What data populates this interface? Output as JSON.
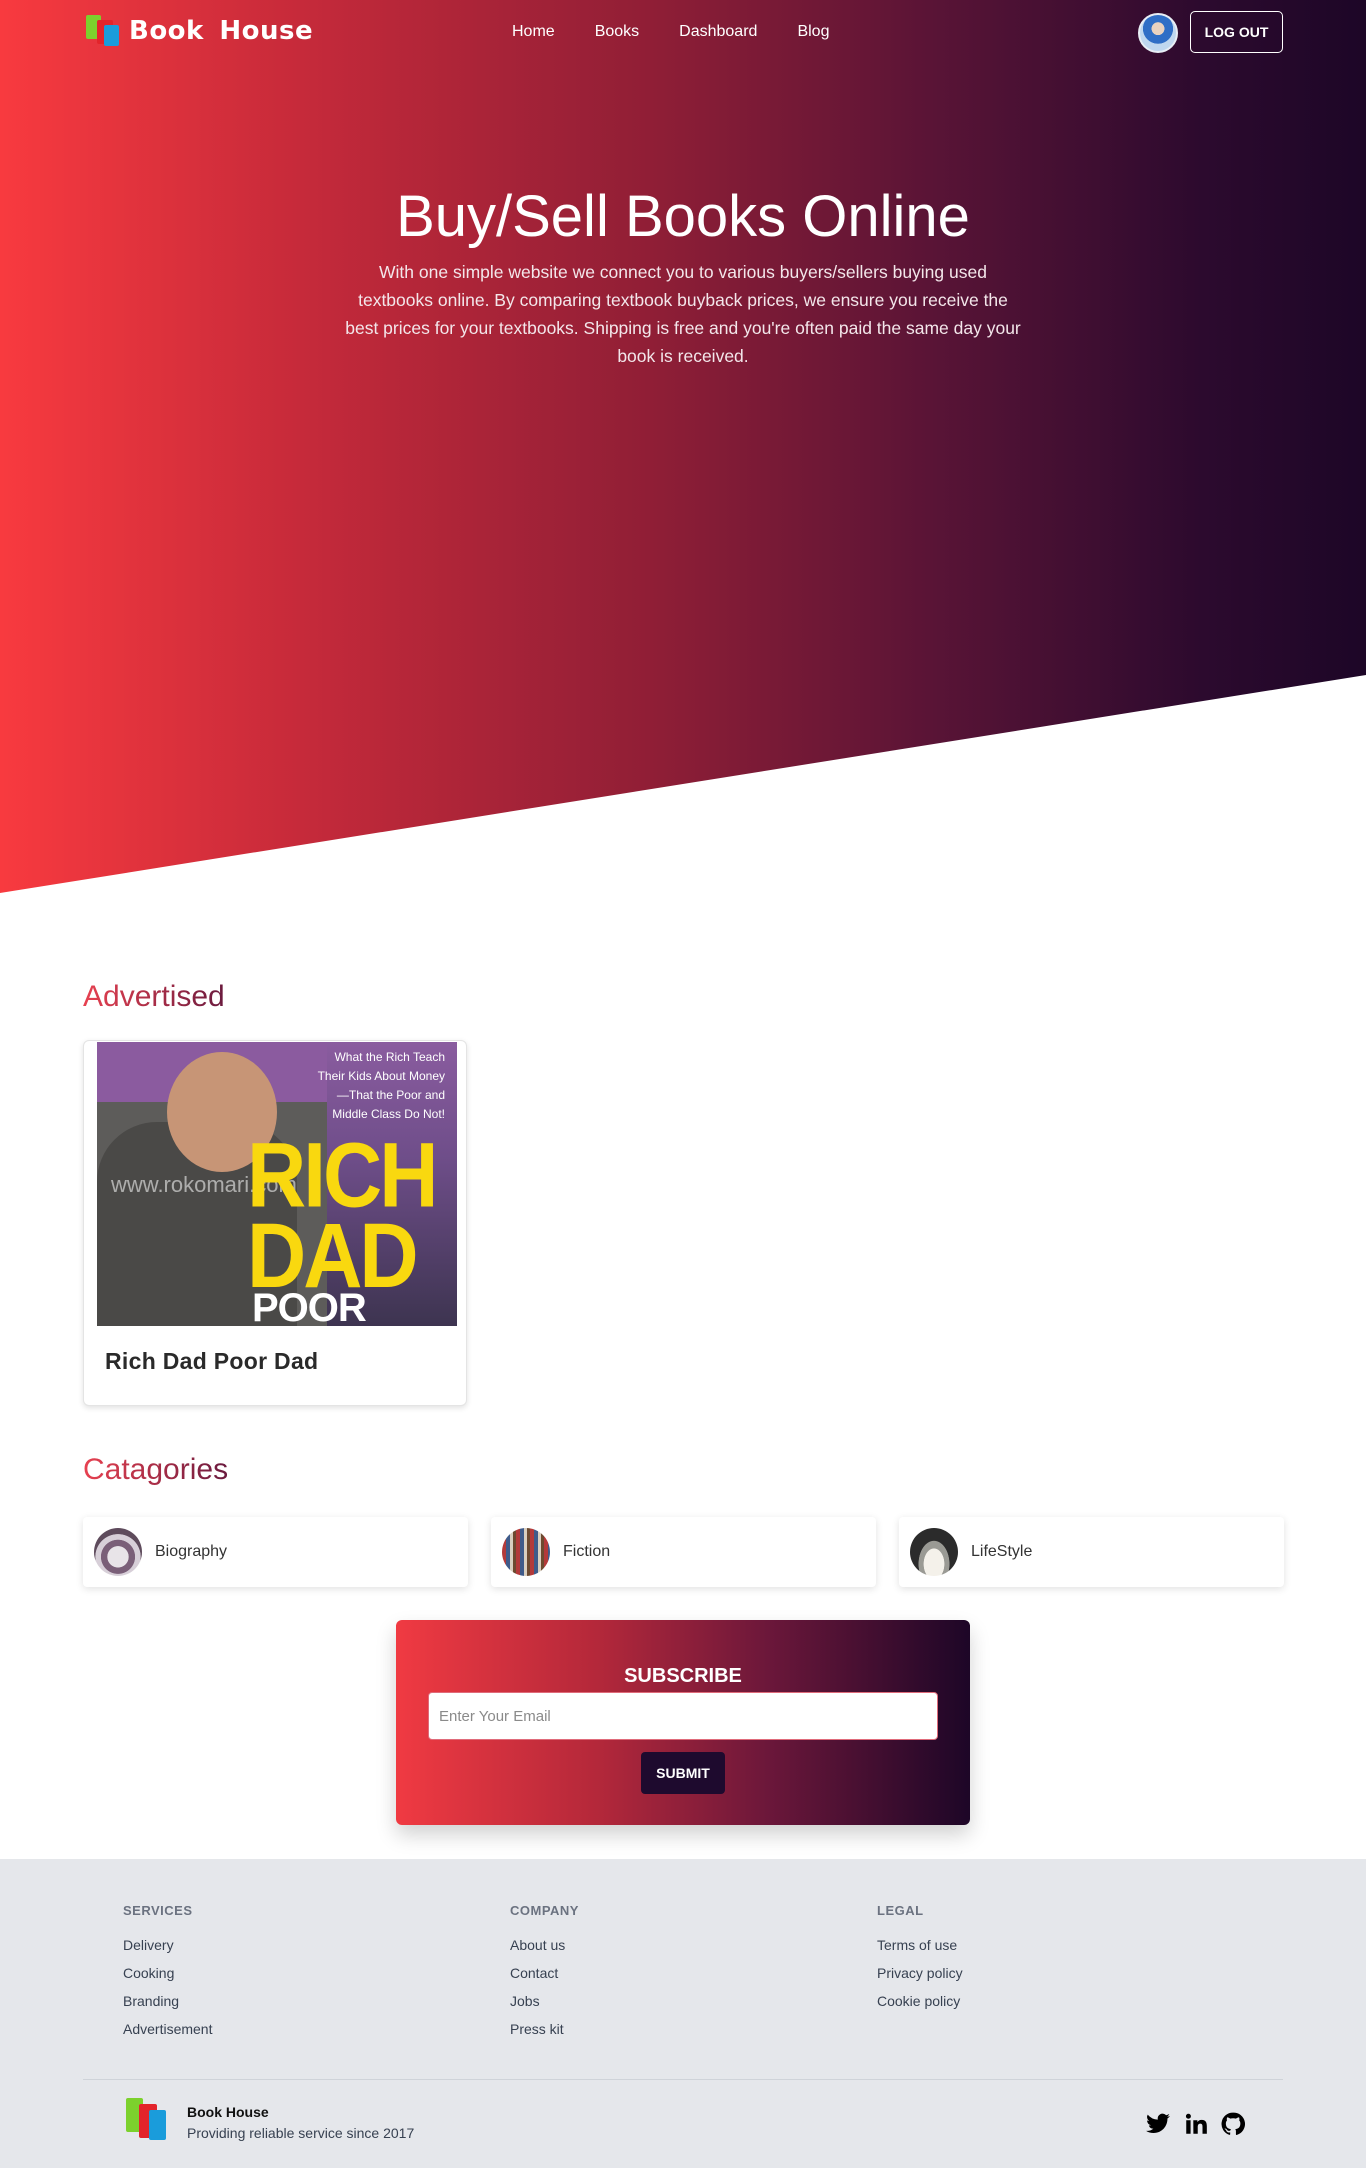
{
  "nav": {
    "brand": "Book  House",
    "links": [
      "Home",
      "Books",
      "Dashboard",
      "Blog"
    ],
    "logout_label": "LOG OUT"
  },
  "hero": {
    "title": "Buy/Sell Books Online",
    "text": "With one simple website we connect you to various buyers/sellers buying used textbooks online. By comparing textbook buyback prices, we ensure you receive the best prices for your textbooks. Shipping is free and you're often paid the same day your book is received."
  },
  "advertised": {
    "heading": "Advertised",
    "books": [
      {
        "title": "Rich Dad Poor Dad",
        "cover_tagline": "What the Rich Teach Their Kids About Money —That the Poor and Middle Class Do Not!",
        "cover_main": "RICH DAD",
        "cover_sub": "POOR DAD",
        "cover_watermark": "www.rokomari.com"
      }
    ]
  },
  "categories": {
    "heading": "Catagories",
    "items": [
      "Biography",
      "Fiction",
      "LifeStyle"
    ]
  },
  "subscribe": {
    "title": "SUBSCRIBE",
    "email_placeholder": "Enter Your Email",
    "submit_label": "SUBMIT"
  },
  "footer": {
    "columns": [
      {
        "heading": "SERVICES",
        "items": [
          "Delivery",
          "Cooking",
          "Branding",
          "Advertisement"
        ]
      },
      {
        "heading": "COMPANY",
        "items": [
          "About us",
          "Contact",
          "Jobs",
          "Press kit"
        ]
      },
      {
        "heading": "LEGAL",
        "items": [
          "Terms of use",
          "Privacy policy",
          "Cookie policy"
        ]
      }
    ],
    "brand": "Book House",
    "tagline": "Providing reliable service since 2017",
    "social_icons": [
      "twitter-icon",
      "linkedin-icon",
      "github-icon"
    ]
  },
  "colors": {
    "hero_start": "#f83a3f",
    "hero_end": "#1d0627",
    "submit_button": "#1e0a2e",
    "footer_bg": "#e5e7eb"
  }
}
